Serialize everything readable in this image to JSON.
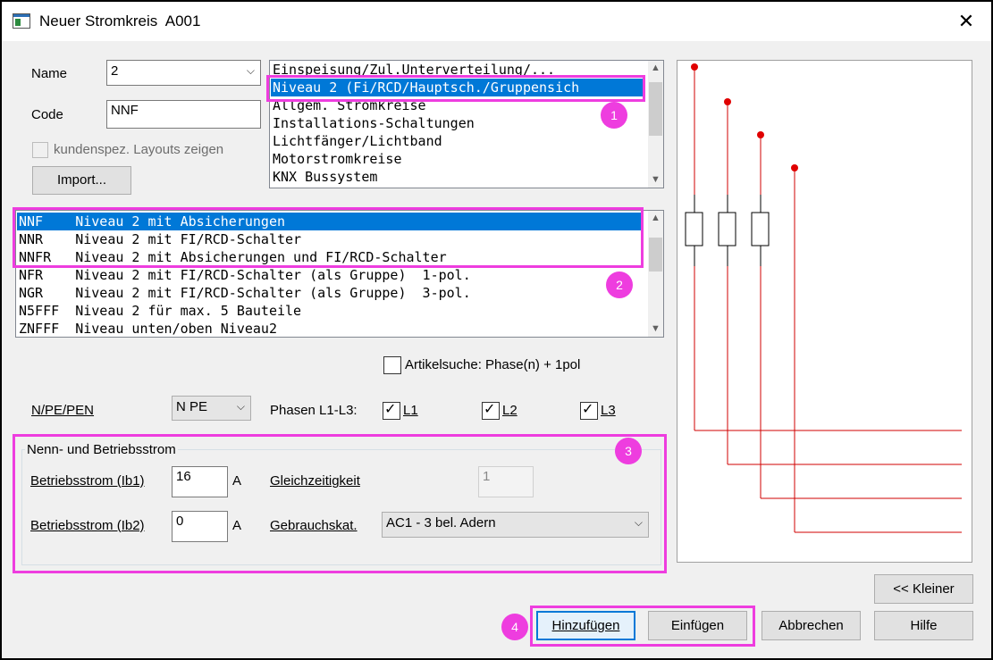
{
  "window": {
    "title": "Neuer Stromkreis  A001",
    "close_symbol": "✕"
  },
  "name": {
    "label": "Name",
    "value": "2"
  },
  "code": {
    "label": "Code",
    "value": "NNF"
  },
  "custom_layouts": {
    "label": "kundenspez. Layouts zeigen",
    "checked": false
  },
  "import_button": "Import...",
  "category_list": {
    "items": [
      "Einspeisung/Zul.Unterverteilung/...",
      "Niveau 2 (Fi/RCD/Hauptsch./Gruppensich",
      "Allgem. Stromkreise",
      "Installations-Schaltungen",
      "Lichtfänger/Lichtband",
      "Motorstromkreise",
      "KNX Bussystem"
    ],
    "selected_index": 1
  },
  "template_list": {
    "items": [
      "NNF    Niveau 2 mit Absicherungen",
      "NNR    Niveau 2 mit FI/RCD-Schalter",
      "NNFR   Niveau 2 mit Absicherungen und FI/RCD-Schalter",
      "NFR    Niveau 2 mit FI/RCD-Schalter (als Gruppe)  1-pol.",
      "NGR    Niveau 2 mit FI/RCD-Schalter (als Gruppe)  3-pol.",
      "N5FFF  Niveau 2 für max. 5 Bauteile",
      "ZNFFF  Niveau unten/oben Niveau2"
    ],
    "selected_index": 0
  },
  "article_search": {
    "label": "Artikelsuche: Phase(n) + 1pol",
    "checked": false
  },
  "npe": {
    "label": "N/PE/PEN",
    "value": "N PE"
  },
  "phases": {
    "label": "Phasen L1-L3:",
    "l1": {
      "label": "L1",
      "checked": true
    },
    "l2": {
      "label": "L2",
      "checked": true
    },
    "l3": {
      "label": "L3",
      "checked": true
    }
  },
  "current_group": {
    "title": "Nenn- und Betriebsstrom",
    "ib1_label": "Betriebsstrom (Ib1)",
    "ib1_value": "16",
    "ib2_label": "Betriebsstrom (Ib2)",
    "ib2_value": "0",
    "unit": "A",
    "simultaneity_label": "Gleichzeitigkeit",
    "simultaneity_value": "1",
    "usage_label": "Gebrauchskat.",
    "usage_value": "AC1 - 3 bel. Adern"
  },
  "badges": {
    "b1": "1",
    "b2": "2",
    "b3": "3",
    "b4": "4"
  },
  "check_mark": "✓",
  "dropdown_arrow": "⌵",
  "scroll_up": "▲",
  "scroll_down": "▼",
  "buttons": {
    "smaller": "<< Kleiner",
    "add": "Hinzufügen",
    "insert": "Einfügen",
    "cancel": "Abbrechen",
    "help": "Hilfe"
  },
  "colors": {
    "highlight": "#ee3ddf",
    "selection": "#0078d7",
    "wire": "#d00000"
  }
}
